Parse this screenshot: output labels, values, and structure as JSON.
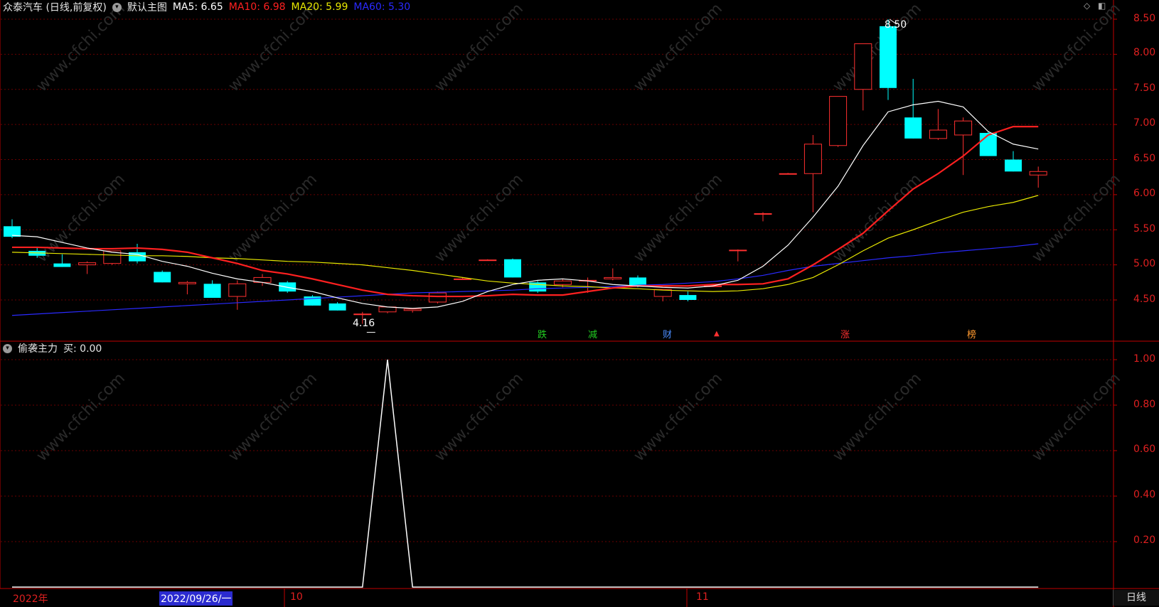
{
  "header": {
    "stock_title": "众泰汽车 (日线,前复权)",
    "main_chart_label": "默认主图",
    "ma": [
      {
        "label": "MA5: 6.65",
        "color": "#ffffff"
      },
      {
        "label": "MA10: 6.98",
        "color": "#ff2020"
      },
      {
        "label": "MA20: 5.99",
        "color": "#e8e800"
      },
      {
        "label": "MA60: 5.30",
        "color": "#2a2aff"
      }
    ]
  },
  "indicator": {
    "name": "偷袭主力",
    "value_label": "买: 0.00"
  },
  "price_axis": [
    "8.50",
    "8.00",
    "7.50",
    "7.00",
    "6.50",
    "6.00",
    "5.50",
    "5.00",
    "4.50"
  ],
  "indicator_axis": [
    "1.00",
    "0.80",
    "0.60",
    "0.40",
    "0.20"
  ],
  "x_axis": [
    {
      "label": "2022年",
      "selected": false
    },
    {
      "label": "2022/09/26/一",
      "selected": true
    },
    {
      "label": "10",
      "selected": false
    },
    {
      "label": "11",
      "selected": false
    }
  ],
  "period_label": "日线",
  "annotations": {
    "high": "8.50",
    "low": "4.16"
  },
  "event_tags": [
    {
      "text": "跌",
      "color": "#22cc22"
    },
    {
      "text": "减",
      "color": "#22cc22"
    },
    {
      "text": "财",
      "color": "#4a8cff"
    },
    {
      "text": "▲",
      "color": "#ff3030"
    },
    {
      "text": "涨",
      "color": "#ff3030"
    },
    {
      "text": "榜",
      "color": "#ff9a30"
    }
  ],
  "watermark": "www.cfchi.com",
  "colors": {
    "up": "#ff3030",
    "down": "#00ffff",
    "axis": "#c00000",
    "grid": "#6a0000"
  },
  "chart_data": {
    "type": "candlestick",
    "ylim": [
      4.2,
      8.6
    ],
    "candles": [
      {
        "o": 5.55,
        "h": 5.65,
        "l": 5.38,
        "c": 5.4
      },
      {
        "o": 5.2,
        "h": 5.25,
        "l": 5.1,
        "c": 5.13
      },
      {
        "o": 5.02,
        "h": 5.15,
        "l": 4.97,
        "c": 4.97
      },
      {
        "o": 5.0,
        "h": 5.05,
        "l": 4.87,
        "c": 5.03
      },
      {
        "o": 5.02,
        "h": 5.2,
        "l": 5.0,
        "c": 5.2
      },
      {
        "o": 5.18,
        "h": 5.3,
        "l": 5.02,
        "c": 5.05
      },
      {
        "o": 4.9,
        "h": 4.92,
        "l": 4.75,
        "c": 4.75
      },
      {
        "o": 4.73,
        "h": 4.77,
        "l": 4.58,
        "c": 4.75
      },
      {
        "o": 4.73,
        "h": 4.78,
        "l": 4.53,
        "c": 4.53
      },
      {
        "o": 4.55,
        "h": 4.78,
        "l": 4.36,
        "c": 4.73
      },
      {
        "o": 4.75,
        "h": 4.87,
        "l": 4.7,
        "c": 4.82
      },
      {
        "o": 4.75,
        "h": 4.77,
        "l": 4.6,
        "c": 4.62
      },
      {
        "o": 4.55,
        "h": 4.57,
        "l": 4.42,
        "c": 4.42
      },
      {
        "o": 4.45,
        "h": 4.47,
        "l": 4.35,
        "c": 4.35
      },
      {
        "o": 4.3,
        "h": 4.33,
        "l": 4.16,
        "c": 4.3
      },
      {
        "o": 4.33,
        "h": 4.4,
        "l": 4.31,
        "c": 4.4
      },
      {
        "o": 4.35,
        "h": 4.38,
        "l": 4.32,
        "c": 4.37
      },
      {
        "o": 4.47,
        "h": 4.62,
        "l": 4.45,
        "c": 4.6
      },
      {
        "o": 4.8,
        "h": 4.82,
        "l": 4.79,
        "c": 4.8
      },
      {
        "o": 5.07,
        "h": 5.08,
        "l": 5.06,
        "c": 5.07
      },
      {
        "o": 5.08,
        "h": 5.09,
        "l": 4.82,
        "c": 4.82
      },
      {
        "o": 4.75,
        "h": 4.77,
        "l": 4.6,
        "c": 4.62
      },
      {
        "o": 4.72,
        "h": 4.8,
        "l": 4.68,
        "c": 4.77
      },
      {
        "o": 4.78,
        "h": 4.82,
        "l": 4.6,
        "c": 4.78
      },
      {
        "o": 4.8,
        "h": 4.95,
        "l": 4.78,
        "c": 4.82
      },
      {
        "o": 4.82,
        "h": 4.85,
        "l": 4.68,
        "c": 4.7
      },
      {
        "o": 4.55,
        "h": 4.63,
        "l": 4.48,
        "c": 4.65
      },
      {
        "o": 4.57,
        "h": 4.62,
        "l": 4.48,
        "c": 4.5
      },
      {
        "o": 4.7,
        "h": 4.72,
        "l": 4.69,
        "c": 4.7
      },
      {
        "o": 5.2,
        "h": 5.22,
        "l": 5.05,
        "c": 5.21
      },
      {
        "o": 5.72,
        "h": 5.75,
        "l": 5.62,
        "c": 5.73
      },
      {
        "o": 6.3,
        "h": 6.31,
        "l": 6.29,
        "c": 6.3
      },
      {
        "o": 6.3,
        "h": 6.85,
        "l": 5.75,
        "c": 6.72
      },
      {
        "o": 6.7,
        "h": 7.4,
        "l": 6.68,
        "c": 7.4
      },
      {
        "o": 7.5,
        "h": 8.15,
        "l": 7.2,
        "c": 8.15
      },
      {
        "o": 8.4,
        "h": 8.5,
        "l": 7.35,
        "c": 7.52
      },
      {
        "o": 7.1,
        "h": 7.65,
        "l": 6.8,
        "c": 6.8
      },
      {
        "o": 6.8,
        "h": 7.22,
        "l": 6.78,
        "c": 6.92
      },
      {
        "o": 6.85,
        "h": 7.1,
        "l": 6.28,
        "c": 7.05
      },
      {
        "o": 6.88,
        "h": 6.9,
        "l": 6.55,
        "c": 6.55
      },
      {
        "o": 6.5,
        "h": 6.62,
        "l": 6.33,
        "c": 6.33
      },
      {
        "o": 6.28,
        "h": 6.4,
        "l": 6.1,
        "c": 6.33
      }
    ],
    "ma5": [
      5.42,
      5.4,
      5.32,
      5.24,
      5.18,
      5.15,
      5.05,
      4.98,
      4.88,
      4.8,
      4.75,
      4.68,
      4.62,
      4.53,
      4.45,
      4.4,
      4.38,
      4.4,
      4.48,
      4.62,
      4.72,
      4.78,
      4.8,
      4.77,
      4.72,
      4.7,
      4.68,
      4.67,
      4.7,
      4.78,
      4.98,
      5.28,
      5.68,
      6.12,
      6.7,
      7.18,
      7.28,
      7.33,
      7.25,
      6.9,
      6.72,
      6.65
    ],
    "ma10": [
      5.25,
      5.25,
      5.24,
      5.23,
      5.23,
      5.24,
      5.22,
      5.18,
      5.1,
      5.02,
      4.92,
      4.87,
      4.8,
      4.72,
      4.64,
      4.58,
      4.56,
      4.55,
      4.55,
      4.56,
      4.58,
      4.57,
      4.57,
      4.62,
      4.67,
      4.7,
      4.7,
      4.7,
      4.72,
      4.72,
      4.73,
      4.8,
      5.0,
      5.22,
      5.45,
      5.77,
      6.08,
      6.3,
      6.55,
      6.85,
      6.97,
      6.97
    ],
    "ma20": [
      5.18,
      5.17,
      5.16,
      5.15,
      5.14,
      5.13,
      5.13,
      5.12,
      5.1,
      5.09,
      5.07,
      5.05,
      5.04,
      5.02,
      5.0,
      4.96,
      4.92,
      4.87,
      4.82,
      4.77,
      4.74,
      4.72,
      4.7,
      4.69,
      4.67,
      4.66,
      4.64,
      4.63,
      4.62,
      4.63,
      4.66,
      4.72,
      4.82,
      5.0,
      5.2,
      5.38,
      5.5,
      5.63,
      5.75,
      5.83,
      5.89,
      5.99
    ],
    "ma60": [
      4.28,
      4.3,
      4.32,
      4.34,
      4.36,
      4.38,
      4.4,
      4.42,
      4.44,
      4.46,
      4.48,
      4.5,
      4.52,
      4.54,
      4.56,
      4.58,
      4.6,
      4.61,
      4.62,
      4.63,
      4.64,
      4.66,
      4.67,
      4.68,
      4.69,
      4.71,
      4.72,
      4.74,
      4.76,
      4.8,
      4.85,
      4.92,
      4.98,
      5.02,
      5.06,
      5.1,
      5.13,
      5.17,
      5.2,
      5.23,
      5.26,
      5.3
    ],
    "indicator_values": [
      0,
      0,
      0,
      0,
      0,
      0,
      0,
      0,
      0,
      0,
      0,
      0,
      0,
      0,
      0,
      1,
      0,
      0,
      0,
      0,
      0,
      0,
      0,
      0,
      0,
      0,
      0,
      0,
      0,
      0,
      0,
      0,
      0,
      0,
      0,
      0,
      0,
      0,
      0,
      0,
      0,
      0
    ],
    "indicator_ylim": [
      0,
      1.0
    ]
  }
}
